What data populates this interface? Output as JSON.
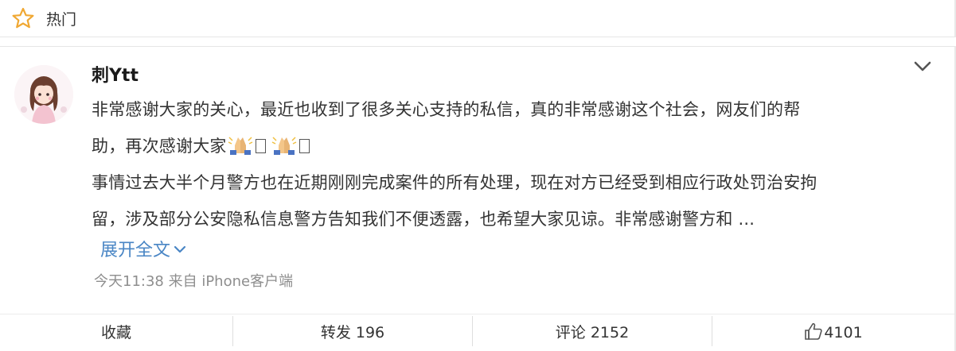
{
  "header": {
    "title": "热门",
    "icon": "star-icon"
  },
  "post": {
    "username": "刺Ytt",
    "avatar": "avatar",
    "content_lines": [
      "非常感谢大家的关心，最近也收到了很多关心支持的私信，真的非常感谢这个社会，网友们的帮",
      "助，再次感谢大家",
      "事情过去大半个月警方也在近期刚刚完成案件的所有处理，现在对方已经受到相应行政处罚治安拘",
      "留，涉及部分公安隐私信息警方告知我们不便透露，也希望大家见谅。非常感谢警方和 ..."
    ],
    "emoji": "folded-hands-emoji",
    "expand_label": "展开全文",
    "meta": "今天11:38 来自 iPhone客户端"
  },
  "actions": {
    "favorite": "收藏",
    "repost": "转发 196",
    "comment": "评论 2152",
    "like_count": "4101"
  },
  "colors": {
    "accent": "#4a86c5",
    "star": "#f0a833",
    "meta": "#8e8e8e"
  }
}
